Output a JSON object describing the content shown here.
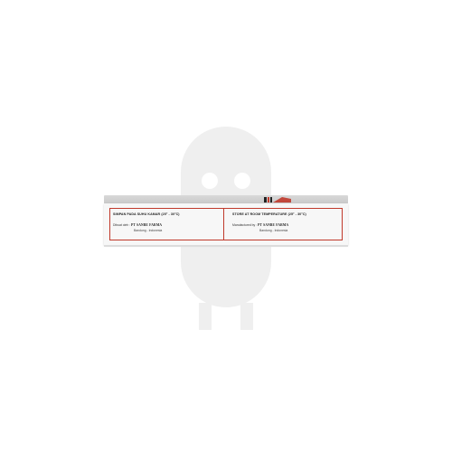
{
  "packaging": {
    "left_panel": {
      "storage": "SIMPAN PADA SUHU KAMAR (25° - 30°C)",
      "made_by_label": "Dibuat oleh :",
      "company": "PT SANBE FARMA",
      "city": "Bandung - Indonesia"
    },
    "right_panel": {
      "storage": "STORE AT ROOM TEMPERATURE (25° - 30°C)",
      "made_by_label": "Manufactured by :",
      "company": "PT SANBE FARMA",
      "city": "Bandung - Indonesia"
    }
  },
  "colors": {
    "accent": "#c0392b",
    "box": "#f7f7f7",
    "box_edge": "#cfcfcf"
  },
  "icons": {
    "watermark": "pill-mascot-icon"
  }
}
